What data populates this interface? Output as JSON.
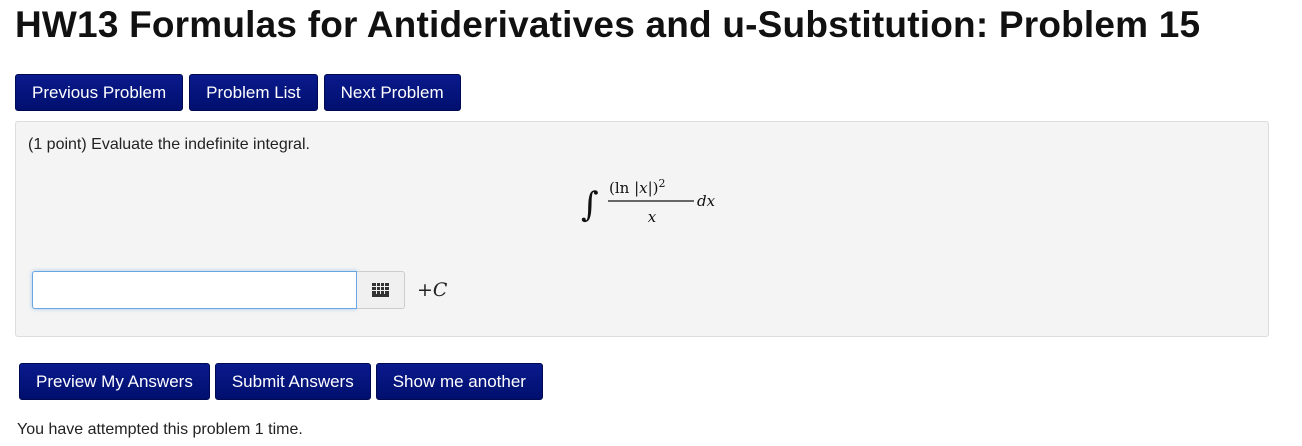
{
  "header": {
    "title": "HW13 Formulas for Antiderivatives and u-Substitution: Problem 15"
  },
  "nav": {
    "previous_label": "Previous Problem",
    "list_label": "Problem List",
    "next_label": "Next Problem"
  },
  "problem": {
    "statement": "(1 point) Evaluate the indefinite integral.",
    "integral": {
      "integral_sign": "∫",
      "numerator_prefix": "(ln |",
      "numerator_var": "x",
      "numerator_suffix": "|)",
      "exponent": "2",
      "denominator": "x",
      "differential": "dx"
    },
    "answer": {
      "value": "",
      "placeholder": "",
      "palette_icon": "grid-icon"
    },
    "constant_prefix": "+",
    "constant_var": "C"
  },
  "actions": {
    "preview_label": "Preview My Answers",
    "submit_label": "Submit Answers",
    "another_label": "Show me another"
  },
  "status": {
    "attempts_text": "You have attempted this problem 1 time."
  },
  "colors": {
    "button_bg": "#00107a",
    "panel_bg": "#f4f4f4",
    "input_focus": "#69a7e3"
  }
}
